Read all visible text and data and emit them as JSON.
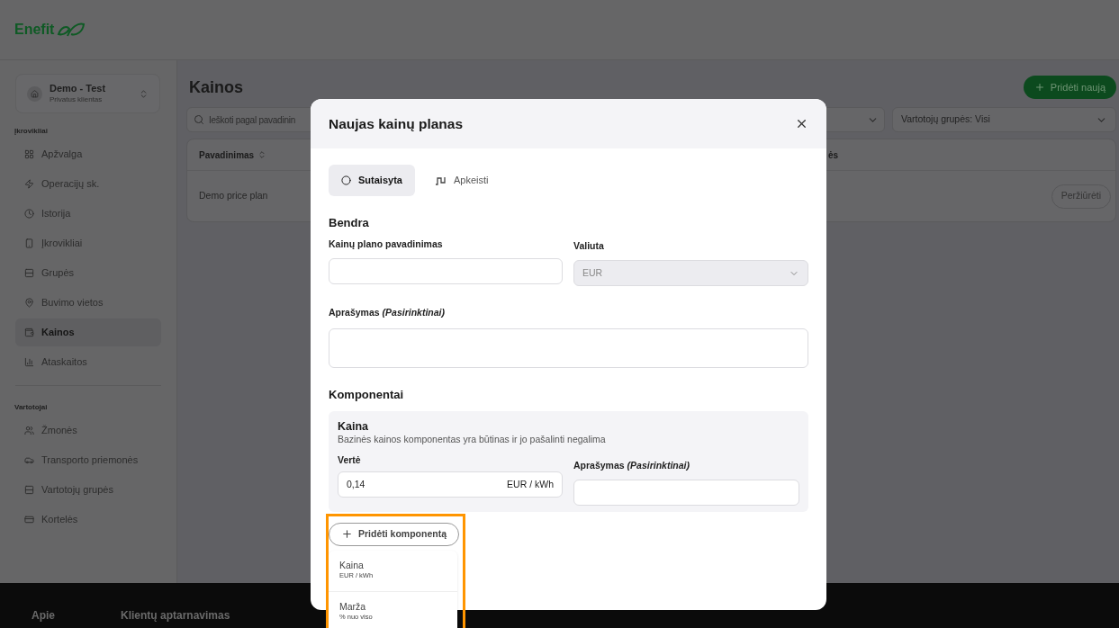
{
  "logo": {
    "text": "Enefit"
  },
  "account": {
    "name": "Demo - Test",
    "subtitle": "Privatus klientas"
  },
  "sidebar": {
    "sections": [
      {
        "title": "Įkrovikliai",
        "items": [
          {
            "label": "Apžvalga",
            "selected": false
          },
          {
            "label": "Operacijų sk.",
            "selected": false
          },
          {
            "label": "Istorija",
            "selected": false
          },
          {
            "label": "Įkrovikliai",
            "selected": false
          },
          {
            "label": "Grupės",
            "selected": false
          },
          {
            "label": "Buvimo vietos",
            "selected": false
          },
          {
            "label": "Kainos",
            "selected": true
          },
          {
            "label": "Ataskaitos",
            "selected": false
          }
        ]
      },
      {
        "title": "Vartotojai",
        "items": [
          {
            "label": "Žmonės",
            "selected": false
          },
          {
            "label": "Transporto priemonės",
            "selected": false
          },
          {
            "label": "Vartotojų grupės",
            "selected": false
          },
          {
            "label": "Kortelės",
            "selected": false
          }
        ]
      }
    ]
  },
  "page": {
    "title": "Kainos",
    "add_button": "Pridėti naują",
    "search": {
      "placeholder": "Ieškoti pagal pavadinin"
    },
    "user_group_filter": "Vartotojų grupės: Visi"
  },
  "table": {
    "columns": [
      "Pavadinimas",
      "ės"
    ],
    "rows": [
      {
        "cells": [
          "Demo price plan"
        ],
        "action": "Peržiūrėti"
      }
    ]
  },
  "modal": {
    "title": "Naujas kainų planas",
    "tabs": [
      {
        "label": "Sutaisyta",
        "selected": true
      },
      {
        "label": "Apkeisti",
        "selected": false
      }
    ],
    "general": {
      "heading": "Bendra",
      "name_label": "Kainų plano pavadinimas",
      "currency_label": "Valiuta",
      "currency_value": "EUR",
      "description_label": "Aprašymas *(Pasirinktinai)*"
    },
    "components": {
      "heading": "Komponentai",
      "card": {
        "title": "Kaina",
        "description": "Bazinės kainos komponentas yra būtinas ir jo pašalinti negalima",
        "value_label": "Vertė",
        "value": "0,14",
        "unit": "EUR / kWh",
        "description_label": "Aprašymas *(Pasirinktinai)*"
      },
      "add_button": "Pridėti komponentą",
      "menu": [
        {
          "label": "Kaina",
          "sublabel": "EUR / kWh"
        },
        {
          "label": "Marža",
          "sublabel": "% nuo viso"
        }
      ]
    }
  },
  "footer": {
    "links": [
      "Apie",
      "Klientų aptarnavimas"
    ]
  }
}
